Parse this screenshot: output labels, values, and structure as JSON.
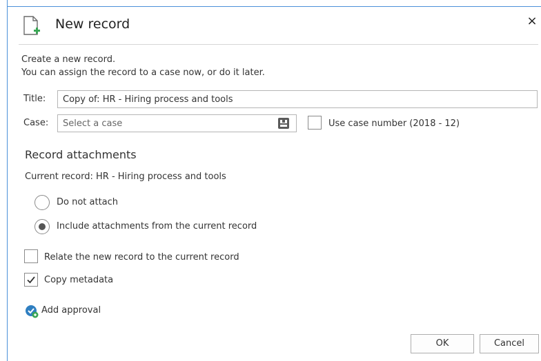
{
  "dialog": {
    "title": "New record",
    "close_label": "×"
  },
  "intro": {
    "line1": "Create a new record.",
    "line2": "You can assign the record to a case now, or do it later."
  },
  "form": {
    "title_label": "Title:",
    "title_value": "Copy of: HR - Hiring process and tools",
    "case_label": "Case:",
    "case_placeholder": "Select a case",
    "case_value": "",
    "use_case_number_label": "Use case number (2018 - 12)",
    "use_case_number_checked": false
  },
  "attachments": {
    "heading": "Record attachments",
    "current_record": "Current record: HR - Hiring process and tools",
    "options": [
      {
        "label": "Do not attach",
        "selected": false
      },
      {
        "label": "Include attachments from the current record",
        "selected": true
      }
    ]
  },
  "options": {
    "relate_label": "Relate the new record to the current record",
    "relate_checked": false,
    "copy_metadata_label": "Copy metadata",
    "copy_metadata_checked": true
  },
  "approval": {
    "label": "Add approval",
    "icon": "add-approval-icon"
  },
  "buttons": {
    "ok": "OK",
    "cancel": "Cancel"
  },
  "colors": {
    "frame_border": "#4a90d9",
    "icon_green": "#3aa655",
    "approval_blue": "#2f7fc1"
  }
}
